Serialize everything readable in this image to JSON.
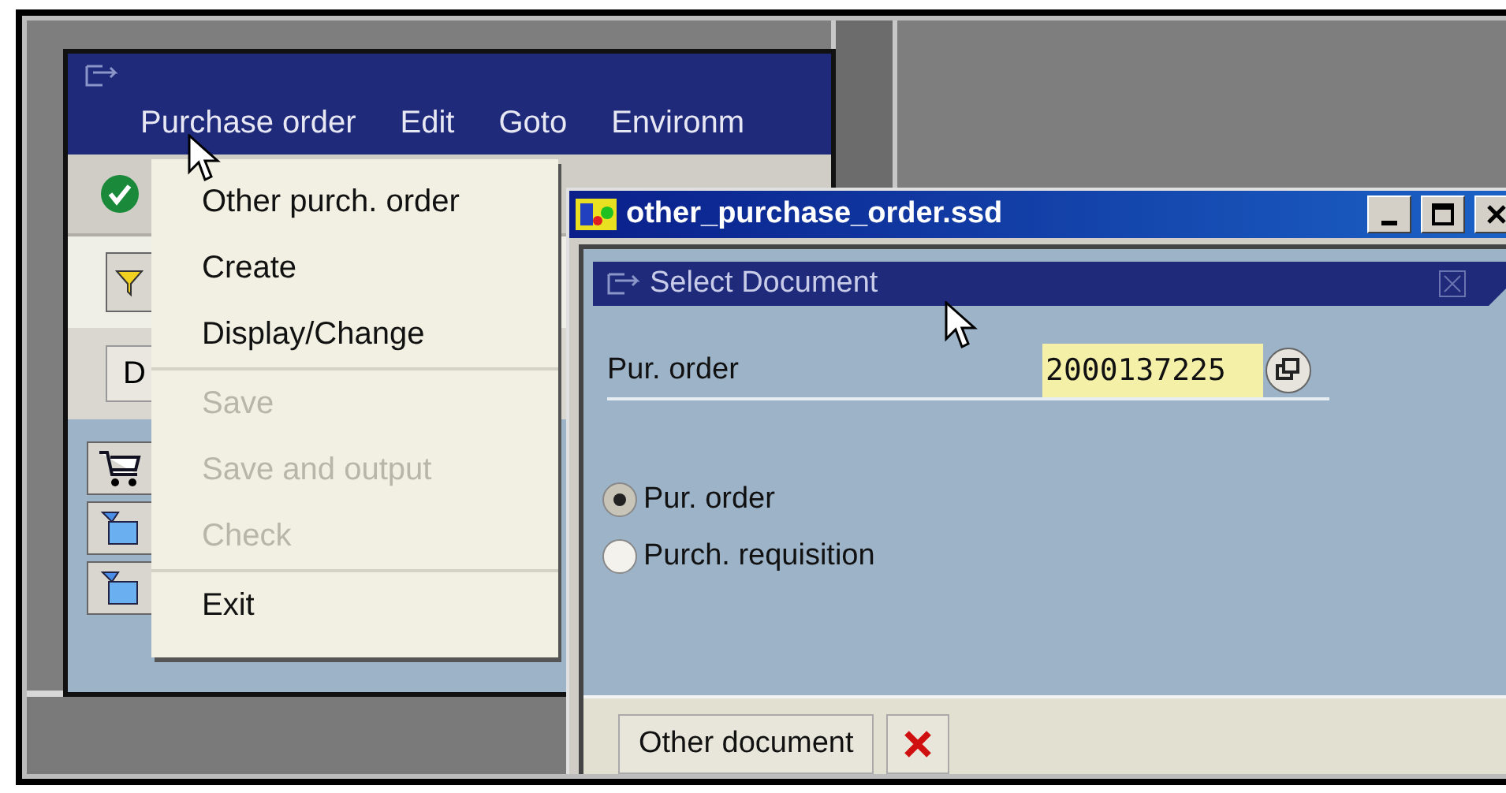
{
  "main_window": {
    "menu_bar": [
      {
        "label": "Purchase order"
      },
      {
        "label": "Edit"
      },
      {
        "label": "Goto"
      },
      {
        "label": "Environm"
      }
    ],
    "partial_button": {
      "label": "D"
    }
  },
  "menu": {
    "groups": [
      [
        {
          "label": "Other purch. order",
          "disabled": false
        },
        {
          "label": "Create",
          "disabled": false
        },
        {
          "label": "Display/Change",
          "disabled": false
        }
      ],
      [
        {
          "label": "Save",
          "disabled": true
        },
        {
          "label": "Save and output",
          "disabled": true
        },
        {
          "label": "Check",
          "disabled": true
        }
      ],
      [
        {
          "label": "Exit",
          "disabled": false
        }
      ]
    ]
  },
  "dialog": {
    "title": "other_purchase_order.ssd",
    "panel_title": "Select Document",
    "field": {
      "label": "Pur. order",
      "value": "2000137225"
    },
    "options": [
      {
        "label": "Pur. order",
        "selected": true
      },
      {
        "label": "Purch. requisition",
        "selected": false
      }
    ],
    "buttons": [
      {
        "kind": "text",
        "label": "Other document"
      },
      {
        "kind": "cancel"
      }
    ]
  }
}
